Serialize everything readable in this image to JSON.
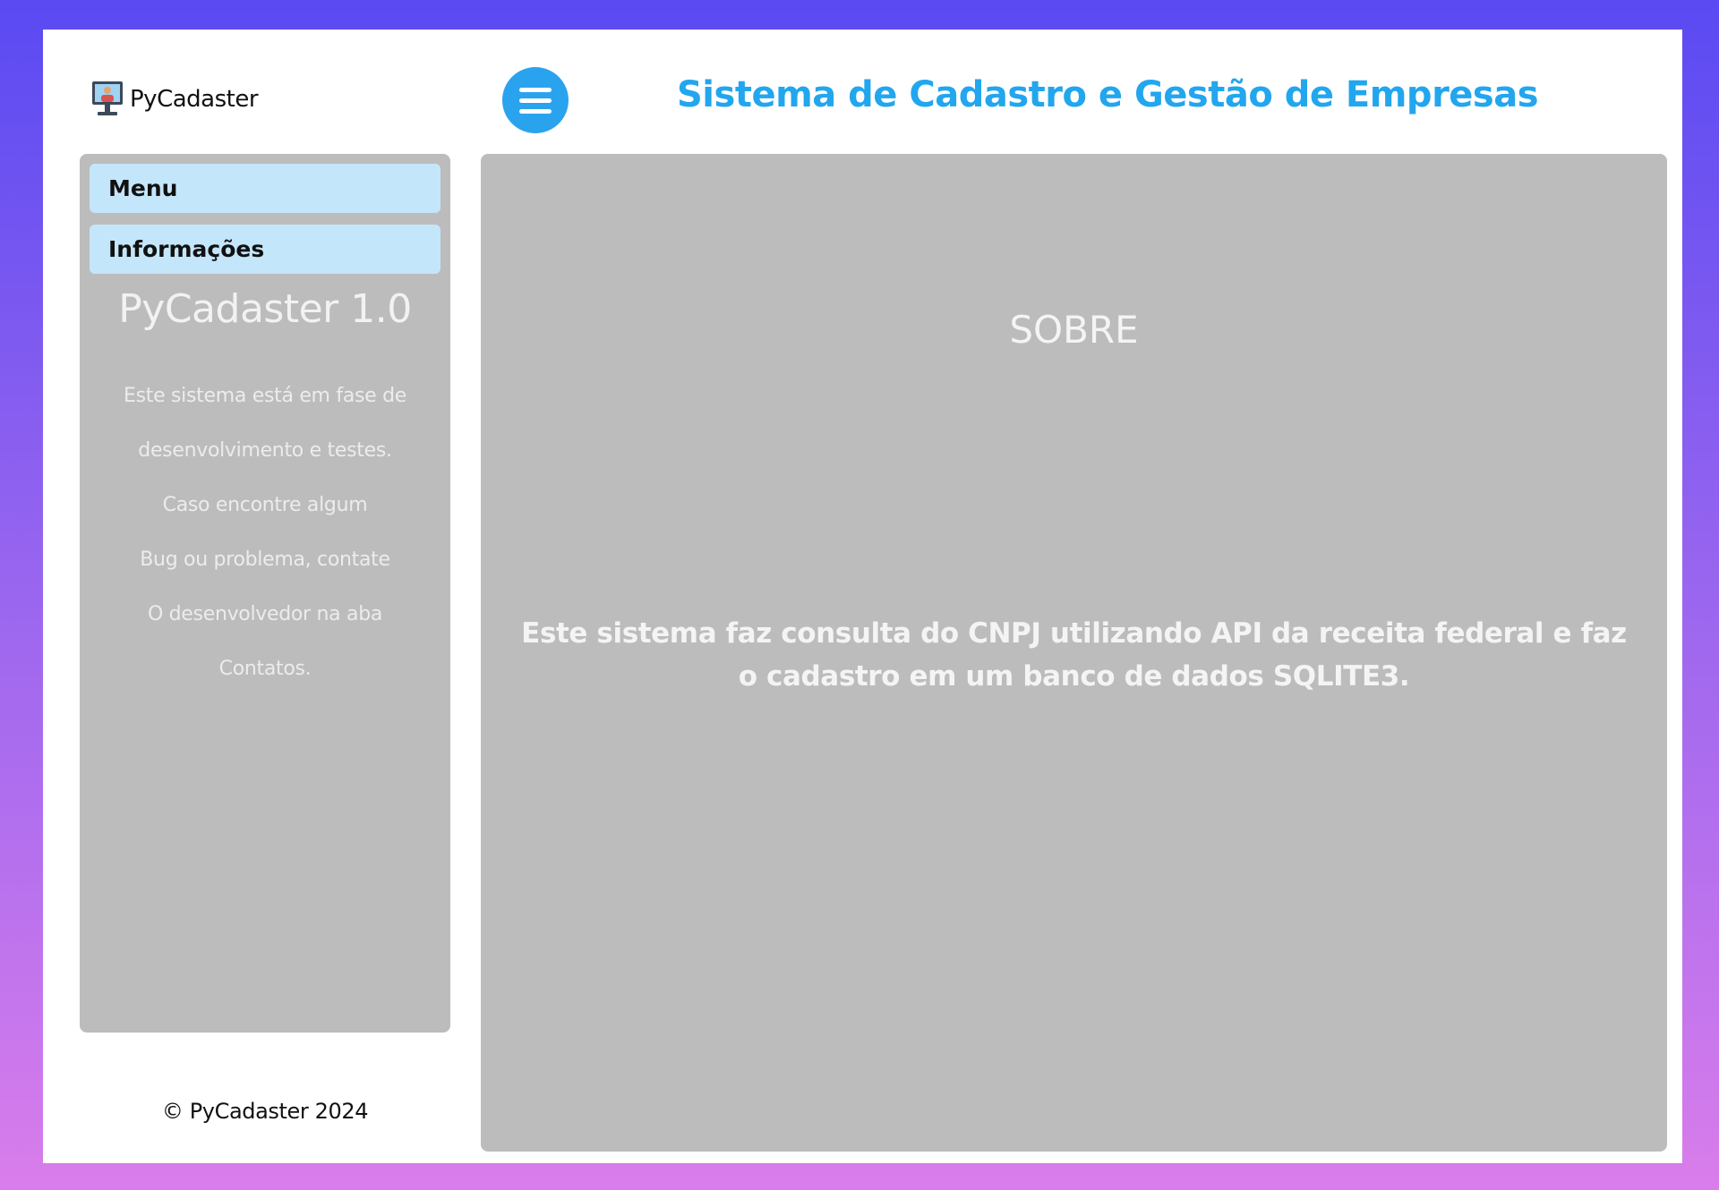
{
  "app": {
    "name": "PyCadaster",
    "logo_icon": "monitor-user-icon"
  },
  "header": {
    "menu_icon": "hamburger-menu-icon",
    "title": "Sistema de Cadastro e Gestão de Empresas"
  },
  "sidebar": {
    "tabs": [
      {
        "label": "Menu"
      },
      {
        "label": "Informações"
      }
    ],
    "version_title": "PyCadaster 1.0",
    "notice_lines": [
      "Este sistema está em fase de",
      "desenvolvimento e testes.",
      "Caso encontre algum",
      "Bug ou problema, contate",
      "O desenvolvedor na aba",
      "Contatos."
    ],
    "footer": "© PyCadaster 2024"
  },
  "content": {
    "heading": "SOBRE",
    "description": "Este sistema faz consulta do CNPJ utilizando API da receita federal e faz o cadastro em um banco de dados SQLITE3."
  },
  "colors": {
    "accent": "#22a6ee",
    "panel": "#bcbcbc",
    "tab": "#c4e6fa",
    "window": "#ffffff"
  }
}
